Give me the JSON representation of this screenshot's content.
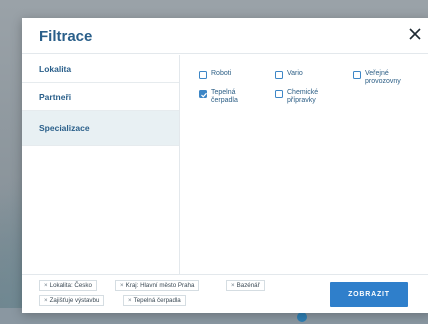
{
  "modal": {
    "title": "Filtrace"
  },
  "sidebar": {
    "items": [
      {
        "label": "Lokalita"
      },
      {
        "label": "Partneři"
      },
      {
        "label": "Specializace"
      }
    ]
  },
  "options": [
    {
      "label": "Roboti",
      "checked": false
    },
    {
      "label": "Vario",
      "checked": false
    },
    {
      "label": "Veřejné provozovny",
      "checked": false
    },
    {
      "label": "Tepelná čerpadla",
      "checked": true
    },
    {
      "label": "Chemické přípravky",
      "checked": false
    }
  ],
  "chips": [
    {
      "label": "Lokalita: Česko"
    },
    {
      "label": "Kraj: Hlavní město Praha"
    },
    {
      "label": "Bazénář"
    },
    {
      "label": "Zajišťuje výstavbu"
    },
    {
      "label": "Tepelná čerpadla"
    }
  ],
  "chip_remove_glyph": "×",
  "footer": {
    "show_label": "ZOBRAZIT"
  },
  "colors": {
    "accent": "#2f7fcb",
    "title": "#2a5f8a",
    "active_bg": "#e8f0f3"
  }
}
